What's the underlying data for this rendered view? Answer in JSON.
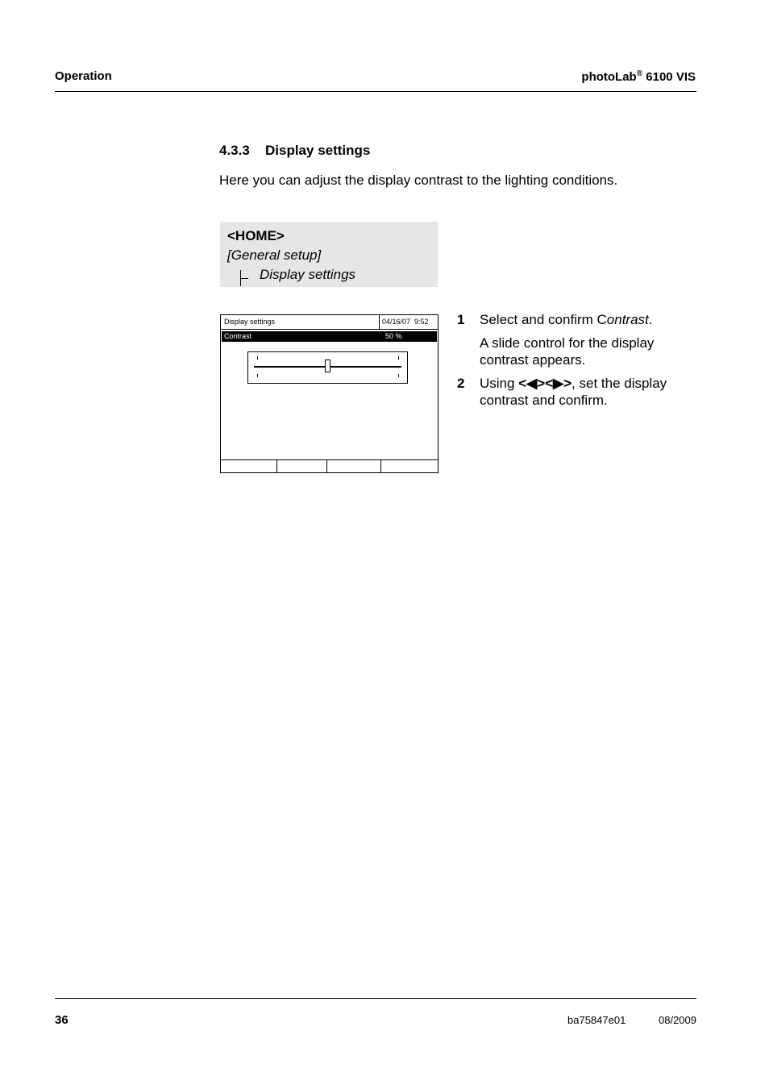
{
  "header": {
    "section": "Operation",
    "product_prefix": "photoLab",
    "product_reg": "®",
    "product_suffix": " 6100 VIS"
  },
  "heading": {
    "number": "4.3.3",
    "title": "Display settings"
  },
  "intro": "Here you can adjust the display contrast to the lighting conditions.",
  "nav": {
    "home": "<HOME>",
    "general": "[General setup]",
    "item": "Display settings"
  },
  "screen": {
    "title": "Display settings",
    "datetime": "04/16/07  9:52",
    "row_label": "Contrast",
    "row_value": "50 %",
    "slider_level": 0.5,
    "softkeys": [
      "",
      "",
      "",
      ""
    ]
  },
  "steps": [
    {
      "num": "1",
      "text_pre": "Select and confirm C",
      "text_em": "ontrast",
      "text_post": ".",
      "note": "A slide control for the display contrast appears."
    },
    {
      "num": "2",
      "text_pre": "Using ",
      "keys": "<◀><▶>",
      "text_post": ", set the display contrast and confirm."
    }
  ],
  "footer": {
    "page": "36",
    "doc": "ba75847e01",
    "date": "08/2009"
  }
}
